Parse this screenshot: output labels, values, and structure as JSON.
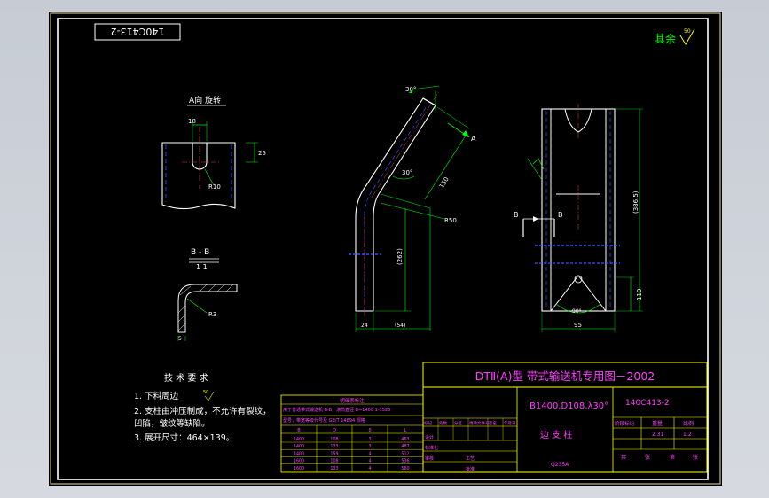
{
  "drawing": {
    "part_code_rotated": "140C413-2",
    "rest_surface_note": "其余",
    "rest_roughness": "50",
    "view_a_title": "A向 旋转",
    "view_a_dim_width": "18",
    "view_a_dim_height": "25",
    "view_a_radius": "R10",
    "section_title": "B - B",
    "section_radius": "R3",
    "section_thickness": "5",
    "side_angle_top": "30°",
    "side_angle_mid": "30°",
    "side_dim_upper": "150",
    "side_dim_radius": "R50",
    "side_dim_lower": "(262)",
    "side_dim_bottom_left": "24",
    "side_dim_bottom_right": "(54)",
    "side_arrow_label": "A",
    "front_height_total": "(386.5)",
    "front_height_lower": "110",
    "front_width": "95",
    "front_angle_bottom": "90°",
    "front_section_left": "B",
    "front_section_right": "B"
  },
  "tech_requirements": {
    "title": "技 术 要 求",
    "items": [
      "1. 下料周边",
      "2. 支柱由冲压制成，不允许有裂纹，",
      "   凹陷，皱纹等缺陷。",
      "3. 展开尺寸：464×139。"
    ],
    "item1_roughness": "50"
  },
  "revision_table": {
    "header": "明细表标注",
    "note_line1": "用于普通带式输送机 B-B，滚筒直径 B=1400 1-1520",
    "note_line2": "型号，带宽等级代号及 GB/T 14894 规格",
    "columns": [
      "B",
      "D",
      "δ",
      "L"
    ],
    "rows": [
      [
        "1400",
        "108",
        "3",
        "463"
      ],
      [
        "1400",
        "133",
        "3",
        "487"
      ],
      [
        "1400",
        "159",
        "4",
        "512"
      ],
      [
        "1600",
        "108",
        "4",
        "536"
      ],
      [
        "1600",
        "133",
        "4",
        "560"
      ]
    ]
  },
  "title_block": {
    "main_title": "DTⅡ(A)型  带式输送机专用图－2002",
    "spec": "B1400,D108,λ30°",
    "drawing_number": "140C413-2",
    "part_name": "边 支 柱",
    "material": "Q235A",
    "weight_label": "重量",
    "scale_label": "比例",
    "weight_value": "2.31",
    "scale_value": "1:2",
    "sheet_label": "共",
    "sheet_label2": "张",
    "sheet_label3": "第",
    "sheet_label4": "张",
    "stage_label": "阶段标记",
    "signature_cols": [
      "标记",
      "处数",
      "分区",
      "更改文件号",
      "签名",
      "年月日"
    ],
    "role_labels": [
      "设计",
      "标准化",
      "审核",
      "工艺",
      "批准"
    ]
  }
}
